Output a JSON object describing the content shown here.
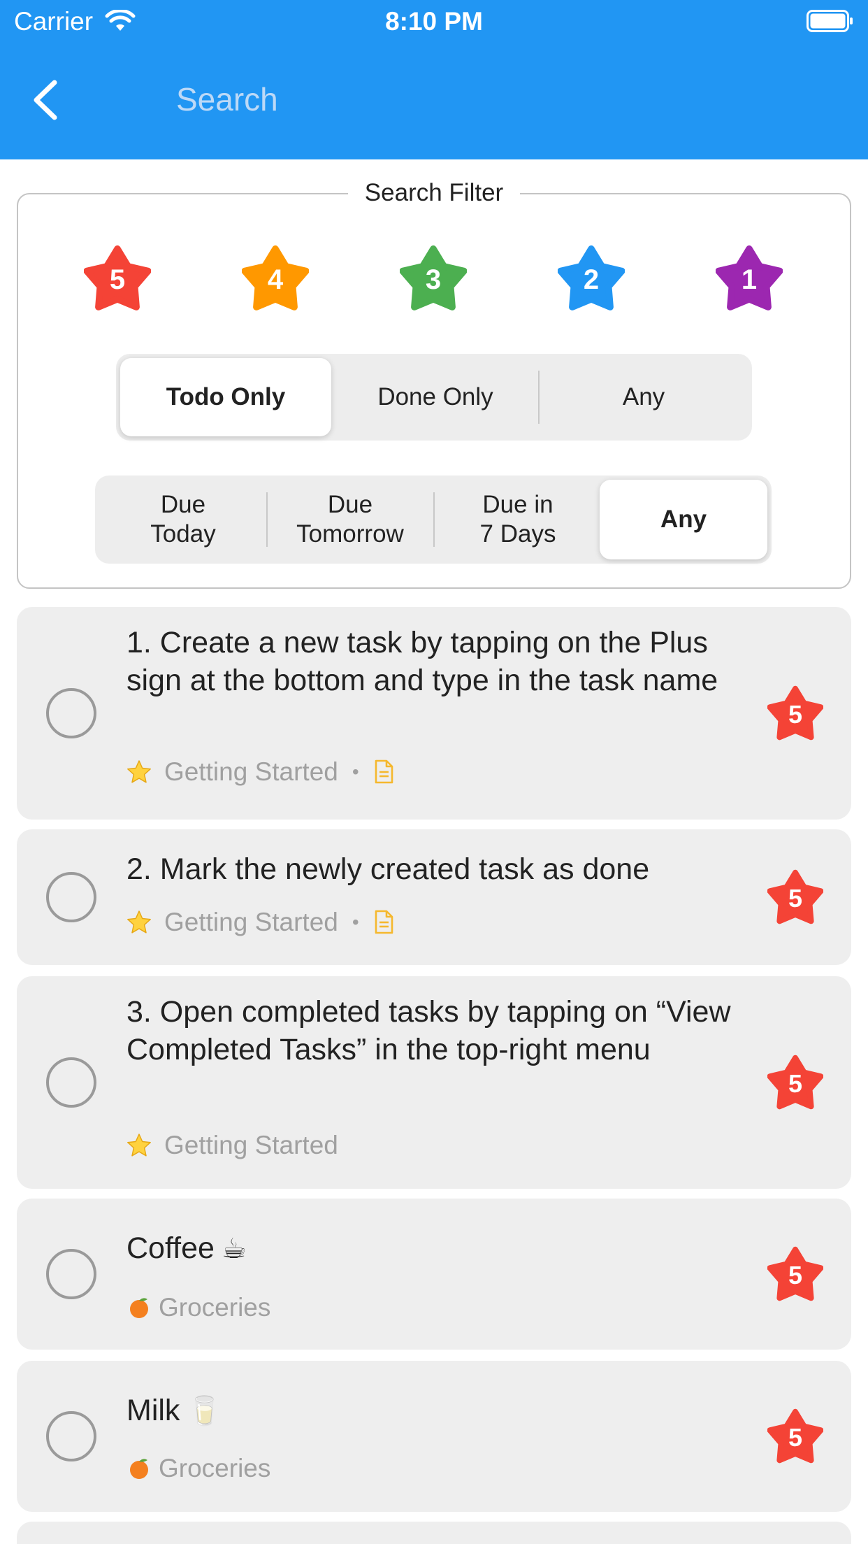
{
  "status_bar": {
    "carrier": "Carrier",
    "time": "8:10 PM"
  },
  "header": {
    "back_icon": "chevron-left-icon",
    "search_placeholder": "Search",
    "background_color": "#2196F3"
  },
  "filter": {
    "legend": "Search Filter",
    "priority_stars": [
      {
        "label": "5",
        "color": "#F44336"
      },
      {
        "label": "4",
        "color": "#FF9800"
      },
      {
        "label": "3",
        "color": "#4CAF50"
      },
      {
        "label": "2",
        "color": "#2196F3"
      },
      {
        "label": "1",
        "color": "#9C27B0"
      }
    ],
    "status_segment": {
      "options": [
        "Todo Only",
        "Done Only",
        "Any"
      ],
      "selected": "Todo Only"
    },
    "due_segment": {
      "options": [
        {
          "line1": "Due",
          "line2": "Today"
        },
        {
          "line1": "Due",
          "line2": "Tomorrow"
        },
        {
          "line1": "Due in",
          "line2": "7 Days"
        },
        {
          "line1": "Any",
          "line2": ""
        }
      ],
      "selected": "Any"
    }
  },
  "tasks": [
    {
      "title": "1. Create a new task by tapping on the Plus sign at the bottom and type in the task name",
      "list_icon": "star-emoji-icon",
      "list": "Getting Started",
      "has_note": true,
      "priority": "5",
      "priority_color": "#F44336"
    },
    {
      "title": "2. Mark the newly created task as done",
      "list_icon": "star-emoji-icon",
      "list": "Getting Started",
      "has_note": true,
      "priority": "5",
      "priority_color": "#F44336"
    },
    {
      "title": "3. Open completed tasks by tapping on “View Completed Tasks” in the top-right menu",
      "list_icon": "star-emoji-icon",
      "list": "Getting Started",
      "has_note": false,
      "priority": "5",
      "priority_color": "#F44336"
    },
    {
      "title": "Coffee",
      "title_emoji": "☕",
      "list_icon": "tangerine-emoji-icon",
      "list": "Groceries",
      "has_note": false,
      "priority": "5",
      "priority_color": "#F44336"
    },
    {
      "title": "Milk",
      "title_emoji": "🥛",
      "list_icon": "tangerine-emoji-icon",
      "list": "Groceries",
      "has_note": false,
      "priority": "5",
      "priority_color": "#F44336"
    }
  ]
}
